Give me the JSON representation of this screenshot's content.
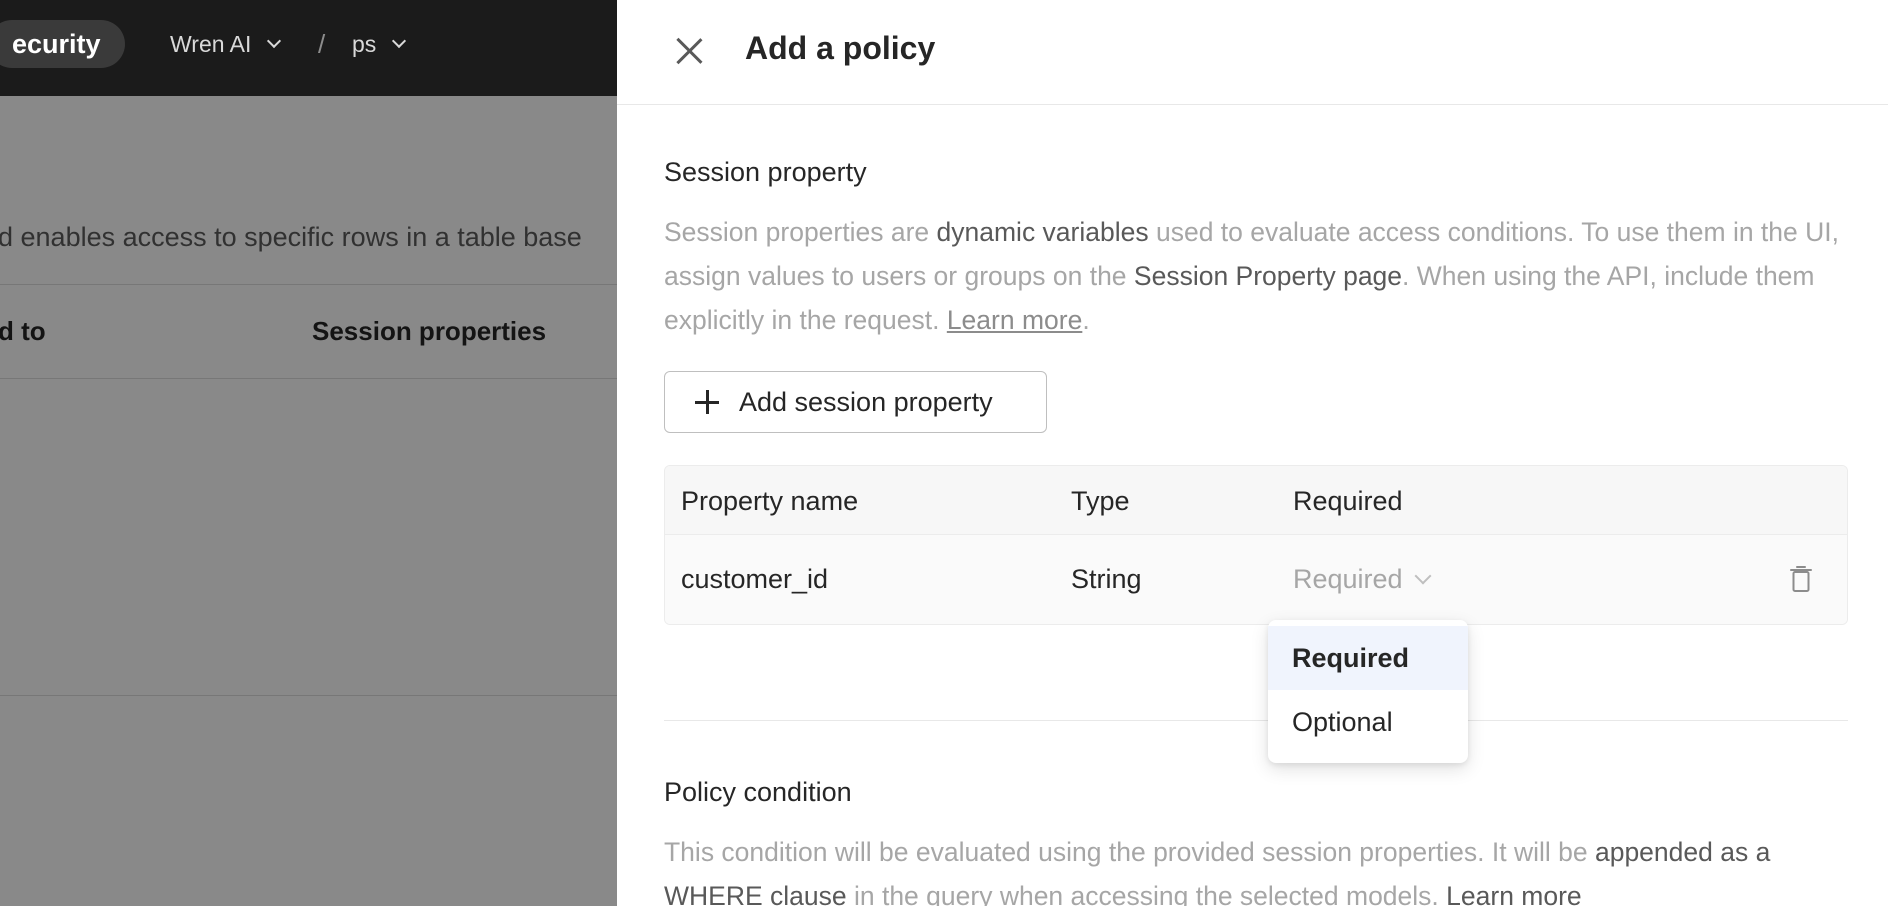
{
  "background": {
    "pill_label": "ecurity",
    "crumb_org": "Wren AI",
    "crumb_separator": "/",
    "crumb_project": "ps",
    "description": "d enables access to specific rows in a table base",
    "col_assigned": "d to",
    "col_session": "Session properties"
  },
  "drawer": {
    "title": "Add a policy",
    "session": {
      "heading": "Session property",
      "desc_1": "Session properties are ",
      "desc_hl_1": "dynamic variables",
      "desc_2": " used to evaluate access conditions. To use them in the UI, assign values to users or groups on the ",
      "desc_hl_2": "Session Property page",
      "desc_3": ". When using the API, include them explicitly in the request. ",
      "desc_link": "Learn more",
      "desc_end": ".",
      "add_button": "Add session property"
    },
    "table": {
      "headers": [
        "Property name",
        "Type",
        "Required"
      ],
      "rows": [
        {
          "name": "customer_id",
          "type": "String",
          "required_placeholder": "Required"
        }
      ]
    },
    "dropdown": {
      "options": [
        "Required",
        "Optional"
      ],
      "active_index": 0
    },
    "condition": {
      "heading": "Policy condition",
      "desc_1": "This condition will be evaluated using the provided session properties. It will be ",
      "desc_hl_1": "appended as a WHERE clause",
      "desc_2": " in the query when accessing the selected models. ",
      "desc_link": "Learn more"
    }
  },
  "colors": {
    "topbar_bg": "#1b1b1b",
    "text_primary": "#262626",
    "text_muted": "#a6a6a6",
    "option_active_bg": "#f0f4fd"
  }
}
